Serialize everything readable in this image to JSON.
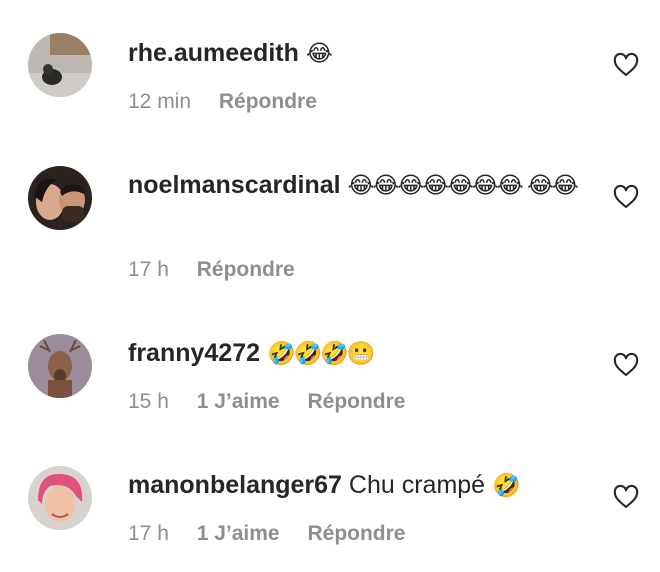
{
  "comments": [
    {
      "username": "rhe.aumeedith",
      "text": "",
      "emoji": "😂",
      "time": "12 min",
      "likes": "",
      "reply": "Répondre",
      "avatar": "avatar-dog"
    },
    {
      "username": "noelmanscardinal",
      "text": "",
      "emoji": "😂😂😂😂😂😂😂 😂😂",
      "time": "17 h",
      "likes": "",
      "reply": "Répondre",
      "avatar": "avatar-couple"
    },
    {
      "username": "franny4272",
      "text": "",
      "emoji": "🤣🤣🤣😬",
      "time": "15 h",
      "likes": "1 J’aime",
      "reply": "Répondre",
      "avatar": "avatar-deer"
    },
    {
      "username": "manonbelanger67",
      "text": "Chu crampé",
      "emoji": "🤣",
      "time": "17 h",
      "likes": "1 J’aime",
      "reply": "Répondre",
      "avatar": "avatar-woman"
    }
  ],
  "icons": {
    "like": "heart-outline-icon"
  },
  "colors": {
    "text": "#262626",
    "muted": "#8e8e8e"
  }
}
